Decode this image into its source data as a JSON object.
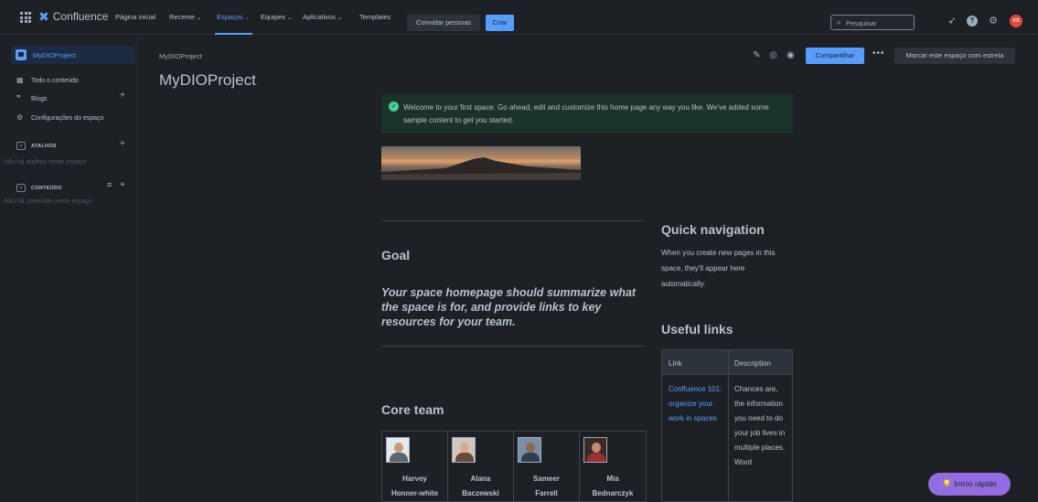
{
  "topnav": {
    "app_name": "Confluence",
    "items": [
      {
        "label": "Página inicial",
        "has_chevron": false
      },
      {
        "label": "Recente",
        "has_chevron": true
      },
      {
        "label": "Espaços",
        "has_chevron": true
      },
      {
        "label": "Equipes",
        "has_chevron": true
      },
      {
        "label": "Aplicativos",
        "has_chevron": true
      },
      {
        "label": "Templates",
        "has_chevron": false
      }
    ],
    "invite_label": "Convidar pessoas",
    "create_label": "Criar",
    "search_placeholder": "Pesquisar",
    "avatar_initials": "VS"
  },
  "sidebar": {
    "space_name": "MyDIOProject",
    "items": [
      {
        "label": "Todo o conteúdo",
        "icon": "content-icon"
      },
      {
        "label": "Blogs",
        "icon": "quote-icon"
      },
      {
        "label": "Configurações do espaço",
        "icon": "settings-icon"
      }
    ],
    "shortcuts_title": "ATALHOS",
    "shortcuts_empty": "Não há atalhos neste espaço",
    "content_title": "CONTEÚDO",
    "content_empty": "Não há conteúdo neste espaço"
  },
  "page": {
    "breadcrumb": "MyDIOProject",
    "title": "MyDIOProject",
    "share_label": "Compartilhar",
    "star_label": "Marcar este espaço com estrela",
    "welcome_message": "Welcome to your first space. Go ahead, edit and customize this home page any way you like. We've added some sample content to get you started.",
    "goal_heading": "Goal",
    "goal_text": "Your space homepage should summarize what the space is for, and provide links to key resources for your team.",
    "core_team_heading": "Core team",
    "team": [
      {
        "first": "Harvey",
        "last": "Honner-white"
      },
      {
        "first": "Alana",
        "last": "Baczewski"
      },
      {
        "first": "Sameer",
        "last": "Farrell"
      },
      {
        "first": "Mia",
        "last": "Bednarczyk"
      }
    ],
    "quick_nav_heading": "Quick navigation",
    "quick_nav_text": "When you create new pages in this space, they'll appear here automatically.",
    "useful_links_heading": "Useful links",
    "links_table": {
      "headers": [
        "Link",
        "Description"
      ],
      "rows": [
        {
          "link": "Confluence 101: organize your work in spaces",
          "description": "Chances are, the information you need to do your job lives in multiple places. Word"
        }
      ]
    },
    "quickstart_label": "Início rápido"
  }
}
